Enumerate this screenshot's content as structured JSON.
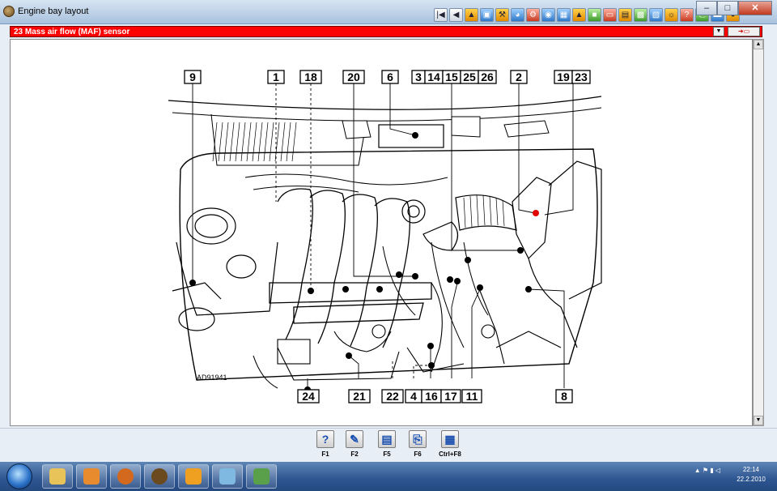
{
  "window": {
    "title": "Engine bay layout"
  },
  "sensor_bar": {
    "label": "23  Mass air flow (MAF) sensor",
    "color": "#ff0000"
  },
  "toolbar_icons": [
    "first-icon",
    "prev-icon",
    "warning-icon",
    "monitor-icon",
    "tools-icon",
    "gauge-icon",
    "wrench-icon",
    "settings-icon",
    "chart-icon",
    "fuel-icon",
    "engine-icon",
    "doc-icon",
    "book-icon",
    "car-icon",
    "ecu-icon",
    "sensor-icon",
    "help-icon",
    "print-icon",
    "save-icon",
    "exit-icon"
  ],
  "diagram": {
    "image_code": "AD91941",
    "top_callouts": [
      "9",
      "1",
      "18",
      "20",
      "6",
      "3",
      "14",
      "15",
      "25",
      "26",
      "2",
      "19",
      "23"
    ],
    "bottom_callouts": [
      "24",
      "21",
      "22",
      "4",
      "16",
      "17",
      "11",
      "8"
    ]
  },
  "function_keys": [
    {
      "label": "F1",
      "icon": "help-icon"
    },
    {
      "label": "F2",
      "icon": "edit-icon"
    },
    {
      "label": "F5",
      "icon": "notes-icon"
    },
    {
      "label": "F6",
      "icon": "print-icon"
    },
    {
      "label": "Ctrl+F8",
      "icon": "table-icon"
    }
  ],
  "taskbar": {
    "clock_time": "22:14",
    "clock_date": "22.2.2010"
  }
}
